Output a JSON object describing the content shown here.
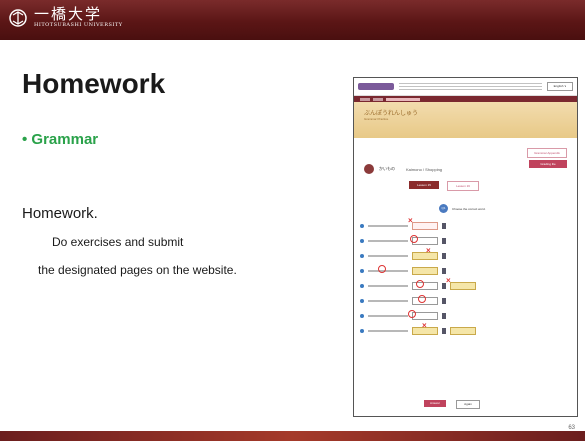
{
  "header": {
    "logo_jp": "一橋大学",
    "logo_en": "HITOTSUBASHI UNIVERSITY"
  },
  "slide": {
    "title": "Homework",
    "bullet": "• Grammar",
    "homework_heading": "Homework.",
    "homework_line1": "Do exercises and submit",
    "homework_line2": "the designated pages on the website.",
    "page_number": "63"
  },
  "screenshot": {
    "language_button": "English ∨",
    "banner_title": "ぶんぽうれんしゅう",
    "banner_subtitle": "Grammar Practice",
    "lesson_jp": "かいもの",
    "lesson_en": "Kaimono / Shopping",
    "right_button_1": "Grammar Appendix",
    "right_button_2": "Grading lite",
    "tab_active": "Lesson 15",
    "tab_inactive": "Lesson 16",
    "question_number": "Q1",
    "question_text": "Choose the correct word.",
    "button_primary": "Answer",
    "button_secondary": "Again"
  },
  "colors": {
    "brand": "#5b1616",
    "bullet_green": "#2aa24a"
  }
}
